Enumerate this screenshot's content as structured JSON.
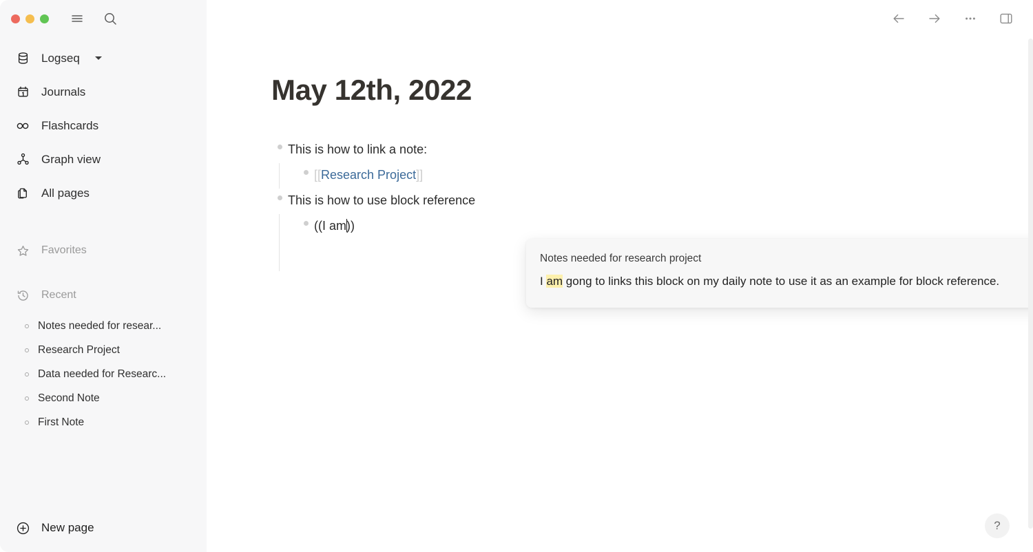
{
  "window": {
    "traffic_lights": [
      {
        "name": "close",
        "color": "#ed6a5e"
      },
      {
        "name": "minimize",
        "color": "#f5be4f"
      },
      {
        "name": "maximize",
        "color": "#61c554"
      }
    ],
    "menu_icon": "hamburger-icon",
    "search_icon": "search-icon"
  },
  "sidebar": {
    "graph": {
      "label": "Logseq",
      "icon": "database-icon"
    },
    "nav": [
      {
        "label": "Journals",
        "icon": "calendar-icon"
      },
      {
        "label": "Flashcards",
        "icon": "infinity-icon"
      },
      {
        "label": "Graph view",
        "icon": "graph-node-icon"
      },
      {
        "label": "All pages",
        "icon": "documents-icon"
      }
    ],
    "favorites": {
      "label": "Favorites",
      "icon": "star-icon"
    },
    "recent": {
      "label": "Recent",
      "icon": "history-clock-icon",
      "items": [
        "Notes needed for resear...",
        "Research Project",
        "Data needed for Researc...",
        "Second Note",
        "First Note"
      ]
    },
    "new_page": {
      "label": "New page",
      "icon": "plus-circle-icon"
    }
  },
  "toolbar": {
    "back": "back-arrow-icon",
    "forward": "forward-arrow-icon",
    "more": "ellipsis-icon",
    "right_sidebar": "right-sidebar-toggle-icon"
  },
  "page": {
    "title": "May 12th, 2022",
    "blocks": [
      {
        "text": "This is how to link a note:",
        "child": {
          "type": "page-reference",
          "open_bracket": "[[",
          "link": "Research Project",
          "close_bracket": "]]"
        }
      },
      {
        "text": "This is how to use block reference",
        "child": {
          "type": "block-reference-editing",
          "before_caret": "((I am",
          "after_caret": "))"
        }
      }
    ]
  },
  "popup": {
    "item_title": "Notes needed for research project",
    "body_before": "I ",
    "body_highlight": "am",
    "body_after": " gong to links this block on my daily note to use it as an example for block reference."
  },
  "help": {
    "label": "?"
  },
  "colors": {
    "sidebar_bg": "#f7f7f8",
    "main_bg": "#ffffff",
    "link": "#3b6a99",
    "bracket": "#cdcdcd",
    "highlight": "#fdf0ad",
    "title": "#36332f",
    "bullet": "#cfcfcf"
  }
}
